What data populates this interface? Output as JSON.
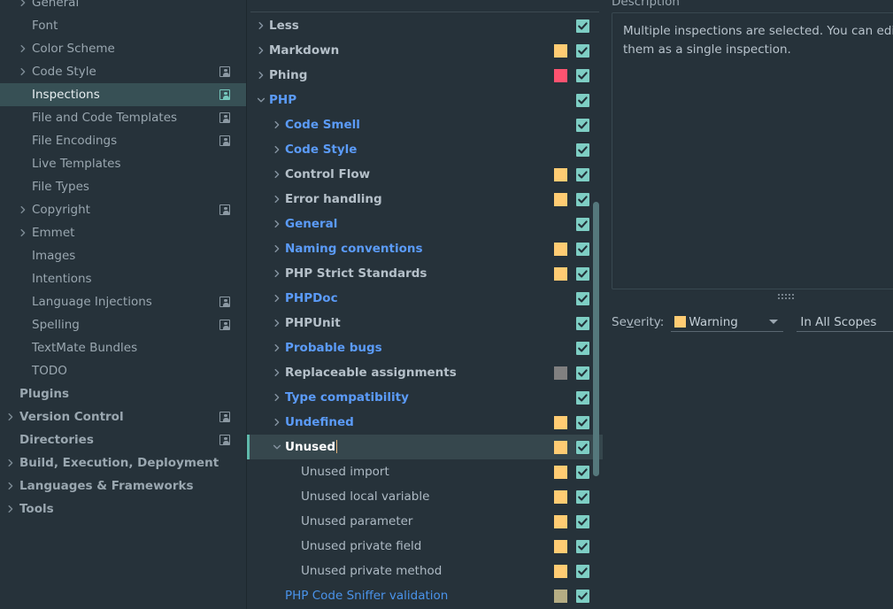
{
  "sidebar": {
    "items": [
      {
        "label": "General",
        "indent": 1,
        "arrow": "chevron-right",
        "bold": false,
        "config_icon": false,
        "selected": false,
        "clipped_top": true
      },
      {
        "label": "Font",
        "indent": 1,
        "arrow": "none",
        "bold": false,
        "config_icon": false,
        "selected": false
      },
      {
        "label": "Color Scheme",
        "indent": 1,
        "arrow": "chevron-right",
        "bold": false,
        "config_icon": false,
        "selected": false
      },
      {
        "label": "Code Style",
        "indent": 1,
        "arrow": "chevron-right",
        "bold": false,
        "config_icon": true,
        "selected": false
      },
      {
        "label": "Inspections",
        "indent": 1,
        "arrow": "none",
        "bold": false,
        "config_icon": true,
        "selected": true
      },
      {
        "label": "File and Code Templates",
        "indent": 1,
        "arrow": "none",
        "bold": false,
        "config_icon": true,
        "selected": false
      },
      {
        "label": "File Encodings",
        "indent": 1,
        "arrow": "none",
        "bold": false,
        "config_icon": true,
        "selected": false
      },
      {
        "label": "Live Templates",
        "indent": 1,
        "arrow": "none",
        "bold": false,
        "config_icon": false,
        "selected": false
      },
      {
        "label": "File Types",
        "indent": 1,
        "arrow": "none",
        "bold": false,
        "config_icon": false,
        "selected": false
      },
      {
        "label": "Copyright",
        "indent": 1,
        "arrow": "chevron-right",
        "bold": false,
        "config_icon": true,
        "selected": false
      },
      {
        "label": "Emmet",
        "indent": 1,
        "arrow": "chevron-right",
        "bold": false,
        "config_icon": false,
        "selected": false
      },
      {
        "label": "Images",
        "indent": 1,
        "arrow": "none",
        "bold": false,
        "config_icon": false,
        "selected": false
      },
      {
        "label": "Intentions",
        "indent": 1,
        "arrow": "none",
        "bold": false,
        "config_icon": false,
        "selected": false
      },
      {
        "label": "Language Injections",
        "indent": 1,
        "arrow": "none",
        "bold": false,
        "config_icon": true,
        "selected": false
      },
      {
        "label": "Spelling",
        "indent": 1,
        "arrow": "none",
        "bold": false,
        "config_icon": true,
        "selected": false
      },
      {
        "label": "TextMate Bundles",
        "indent": 1,
        "arrow": "none",
        "bold": false,
        "config_icon": false,
        "selected": false
      },
      {
        "label": "TODO",
        "indent": 1,
        "arrow": "none",
        "bold": false,
        "config_icon": false,
        "selected": false
      },
      {
        "label": "Plugins",
        "indent": 0,
        "arrow": "none",
        "bold": true,
        "config_icon": false,
        "selected": false
      },
      {
        "label": "Version Control",
        "indent": 0,
        "arrow": "chevron-right",
        "bold": true,
        "config_icon": true,
        "selected": false
      },
      {
        "label": "Directories",
        "indent": 0,
        "arrow": "none",
        "bold": true,
        "config_icon": true,
        "selected": false
      },
      {
        "label": "Build, Execution, Deployment",
        "indent": 0,
        "arrow": "chevron-right",
        "bold": true,
        "config_icon": false,
        "selected": false
      },
      {
        "label": "Languages & Frameworks",
        "indent": 0,
        "arrow": "chevron-right",
        "bold": true,
        "config_icon": false,
        "selected": false
      },
      {
        "label": "Tools",
        "indent": 0,
        "arrow": "chevron-right",
        "bold": true,
        "config_icon": false,
        "selected": false
      }
    ]
  },
  "tree": {
    "rows": [
      {
        "label": "Less",
        "indent": 0,
        "arrow": "chevron-right",
        "style": "bold",
        "severity": "none",
        "checked": true,
        "selected": false
      },
      {
        "label": "Markdown",
        "indent": 0,
        "arrow": "chevron-right",
        "style": "bold",
        "severity": "warning",
        "checked": true,
        "selected": false
      },
      {
        "label": "Phing",
        "indent": 0,
        "arrow": "chevron-right",
        "style": "bold",
        "severity": "error",
        "checked": true,
        "selected": false
      },
      {
        "label": "PHP",
        "indent": 0,
        "arrow": "chevron-down",
        "style": "bold-blue",
        "severity": "none",
        "checked": true,
        "selected": false
      },
      {
        "label": "Code Smell",
        "indent": 1,
        "arrow": "chevron-right",
        "style": "bold-blue",
        "severity": "none",
        "checked": true,
        "selected": false
      },
      {
        "label": "Code Style",
        "indent": 1,
        "arrow": "chevron-right",
        "style": "bold-blue",
        "severity": "none",
        "checked": true,
        "selected": false
      },
      {
        "label": "Control Flow",
        "indent": 1,
        "arrow": "chevron-right",
        "style": "bold",
        "severity": "warning",
        "checked": true,
        "selected": false
      },
      {
        "label": "Error handling",
        "indent": 1,
        "arrow": "chevron-right",
        "style": "bold",
        "severity": "warning",
        "checked": true,
        "selected": false
      },
      {
        "label": "General",
        "indent": 1,
        "arrow": "chevron-right",
        "style": "bold-blue",
        "severity": "none",
        "checked": true,
        "selected": false
      },
      {
        "label": "Naming conventions",
        "indent": 1,
        "arrow": "chevron-right",
        "style": "bold-blue",
        "severity": "warning",
        "checked": true,
        "selected": false
      },
      {
        "label": "PHP Strict Standards",
        "indent": 1,
        "arrow": "chevron-right",
        "style": "bold",
        "severity": "warning",
        "checked": true,
        "selected": false
      },
      {
        "label": "PHPDoc",
        "indent": 1,
        "arrow": "chevron-right",
        "style": "bold-blue",
        "severity": "none",
        "checked": true,
        "selected": false
      },
      {
        "label": "PHPUnit",
        "indent": 1,
        "arrow": "chevron-right",
        "style": "bold",
        "severity": "none",
        "checked": true,
        "selected": false
      },
      {
        "label": "Probable bugs",
        "indent": 1,
        "arrow": "chevron-right",
        "style": "bold-blue",
        "severity": "none",
        "checked": true,
        "selected": false
      },
      {
        "label": "Replaceable assignments",
        "indent": 1,
        "arrow": "chevron-right",
        "style": "bold",
        "severity": "grayed",
        "checked": true,
        "selected": false
      },
      {
        "label": "Type compatibility",
        "indent": 1,
        "arrow": "chevron-right",
        "style": "bold-blue",
        "severity": "none",
        "checked": true,
        "selected": false
      },
      {
        "label": "Undefined",
        "indent": 1,
        "arrow": "chevron-right",
        "style": "bold-blue",
        "severity": "warning",
        "checked": true,
        "selected": false
      },
      {
        "label": "Unused",
        "indent": 1,
        "arrow": "chevron-down",
        "style": "bold-white",
        "severity": "warning",
        "checked": true,
        "selected": true
      },
      {
        "label": "Unused import",
        "indent": 2,
        "arrow": "none",
        "style": "plain",
        "severity": "warning",
        "checked": true,
        "selected": false
      },
      {
        "label": "Unused local variable",
        "indent": 2,
        "arrow": "none",
        "style": "plain",
        "severity": "warning",
        "checked": true,
        "selected": false
      },
      {
        "label": "Unused parameter",
        "indent": 2,
        "arrow": "none",
        "style": "plain",
        "severity": "warning",
        "checked": true,
        "selected": false
      },
      {
        "label": "Unused private field",
        "indent": 2,
        "arrow": "none",
        "style": "plain",
        "severity": "warning",
        "checked": true,
        "selected": false
      },
      {
        "label": "Unused private method",
        "indent": 2,
        "arrow": "none",
        "style": "plain",
        "severity": "warning",
        "checked": true,
        "selected": false
      },
      {
        "label": "PHP Code Sniffer validation",
        "indent": 1,
        "arrow": "none",
        "style": "link-plain",
        "severity": "olive",
        "checked": true,
        "selected": false
      }
    ]
  },
  "description_panel": {
    "title": "Description",
    "text": "Multiple inspections are selected. You can edit them as a single inspection."
  },
  "severity_bar": {
    "label_prefix": "Se",
    "label_mnemonic": "v",
    "label_suffix": "erity:",
    "severity_value": "Warning",
    "scope_value": "In All Scopes"
  },
  "colors": {
    "background": "#26323a",
    "sidebar_selected": "#375055",
    "tree_selected": "#36474d",
    "selection_accent": "#5fb8ab",
    "checkbox": "#7ecec4",
    "severity_warning": "#ffcc73",
    "severity_error": "#ff5370",
    "severity_grayed": "#808080",
    "severity_olive": "#b5ad84",
    "link_blue": "#5b9bf8",
    "text_primary": "#b5c0c9",
    "text_muted": "#9aa7b0"
  }
}
